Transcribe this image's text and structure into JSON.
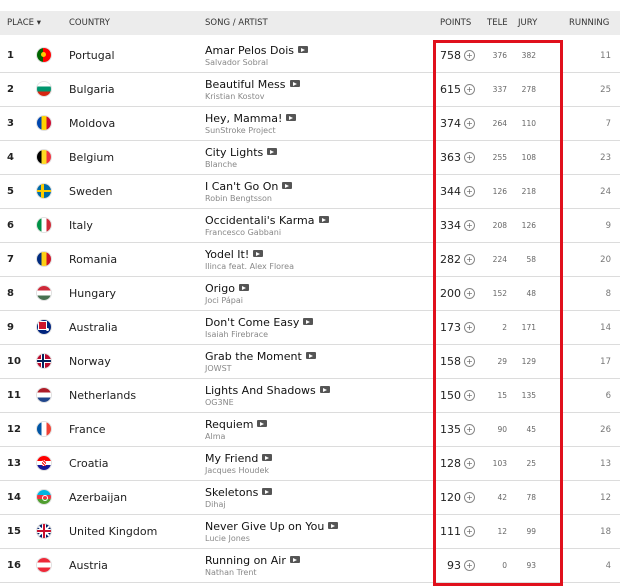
{
  "header": {
    "place": "PLACE ▾",
    "country": "COUNTRY",
    "song": "SONG / ARTIST",
    "points": "POINTS",
    "tele": "TELE",
    "jury": "JURY",
    "running": "RUNNING"
  },
  "accent": "#e0101c",
  "rows": [
    {
      "place": "1",
      "country": "Portugal",
      "song": "Amar Pelos Dois",
      "artist": "Salvador Sobral",
      "points": "758",
      "tele": "376",
      "jury": "382",
      "running": "11"
    },
    {
      "place": "2",
      "country": "Bulgaria",
      "song": "Beautiful Mess",
      "artist": "Kristian Kostov",
      "points": "615",
      "tele": "337",
      "jury": "278",
      "running": "25"
    },
    {
      "place": "3",
      "country": "Moldova",
      "song": "Hey, Mamma!",
      "artist": "SunStroke Project",
      "points": "374",
      "tele": "264",
      "jury": "110",
      "running": "7"
    },
    {
      "place": "4",
      "country": "Belgium",
      "song": "City Lights",
      "artist": "Blanche",
      "points": "363",
      "tele": "255",
      "jury": "108",
      "running": "23"
    },
    {
      "place": "5",
      "country": "Sweden",
      "song": "I Can't Go On",
      "artist": "Robin Bengtsson",
      "points": "344",
      "tele": "126",
      "jury": "218",
      "running": "24"
    },
    {
      "place": "6",
      "country": "Italy",
      "song": "Occidentali's Karma",
      "artist": "Francesco Gabbani",
      "points": "334",
      "tele": "208",
      "jury": "126",
      "running": "9"
    },
    {
      "place": "7",
      "country": "Romania",
      "song": "Yodel It!",
      "artist": "Ilinca feat. Alex Florea",
      "points": "282",
      "tele": "224",
      "jury": "58",
      "running": "20"
    },
    {
      "place": "8",
      "country": "Hungary",
      "song": "Origo",
      "artist": "Joci Pápai",
      "points": "200",
      "tele": "152",
      "jury": "48",
      "running": "8"
    },
    {
      "place": "9",
      "country": "Australia",
      "song": "Don't Come Easy",
      "artist": "Isaiah Firebrace",
      "points": "173",
      "tele": "2",
      "jury": "171",
      "running": "14"
    },
    {
      "place": "10",
      "country": "Norway",
      "song": "Grab the Moment",
      "artist": "JOWST",
      "points": "158",
      "tele": "29",
      "jury": "129",
      "running": "17"
    },
    {
      "place": "11",
      "country": "Netherlands",
      "song": "Lights And Shadows",
      "artist": "OG3NE",
      "points": "150",
      "tele": "15",
      "jury": "135",
      "running": "6"
    },
    {
      "place": "12",
      "country": "France",
      "song": "Requiem",
      "artist": "Alma",
      "points": "135",
      "tele": "90",
      "jury": "45",
      "running": "26"
    },
    {
      "place": "13",
      "country": "Croatia",
      "song": "My Friend",
      "artist": "Jacques Houdek",
      "points": "128",
      "tele": "103",
      "jury": "25",
      "running": "13"
    },
    {
      "place": "14",
      "country": "Azerbaijan",
      "song": "Skeletons",
      "artist": "Dihaj",
      "points": "120",
      "tele": "42",
      "jury": "78",
      "running": "12"
    },
    {
      "place": "15",
      "country": "United Kingdom",
      "song": "Never Give Up on You",
      "artist": "Lucie Jones",
      "points": "111",
      "tele": "12",
      "jury": "99",
      "running": "18"
    },
    {
      "place": "16",
      "country": "Austria",
      "song": "Running on Air",
      "artist": "Nathan Trent",
      "points": "93",
      "tele": "0",
      "jury": "93",
      "running": "4"
    }
  ]
}
